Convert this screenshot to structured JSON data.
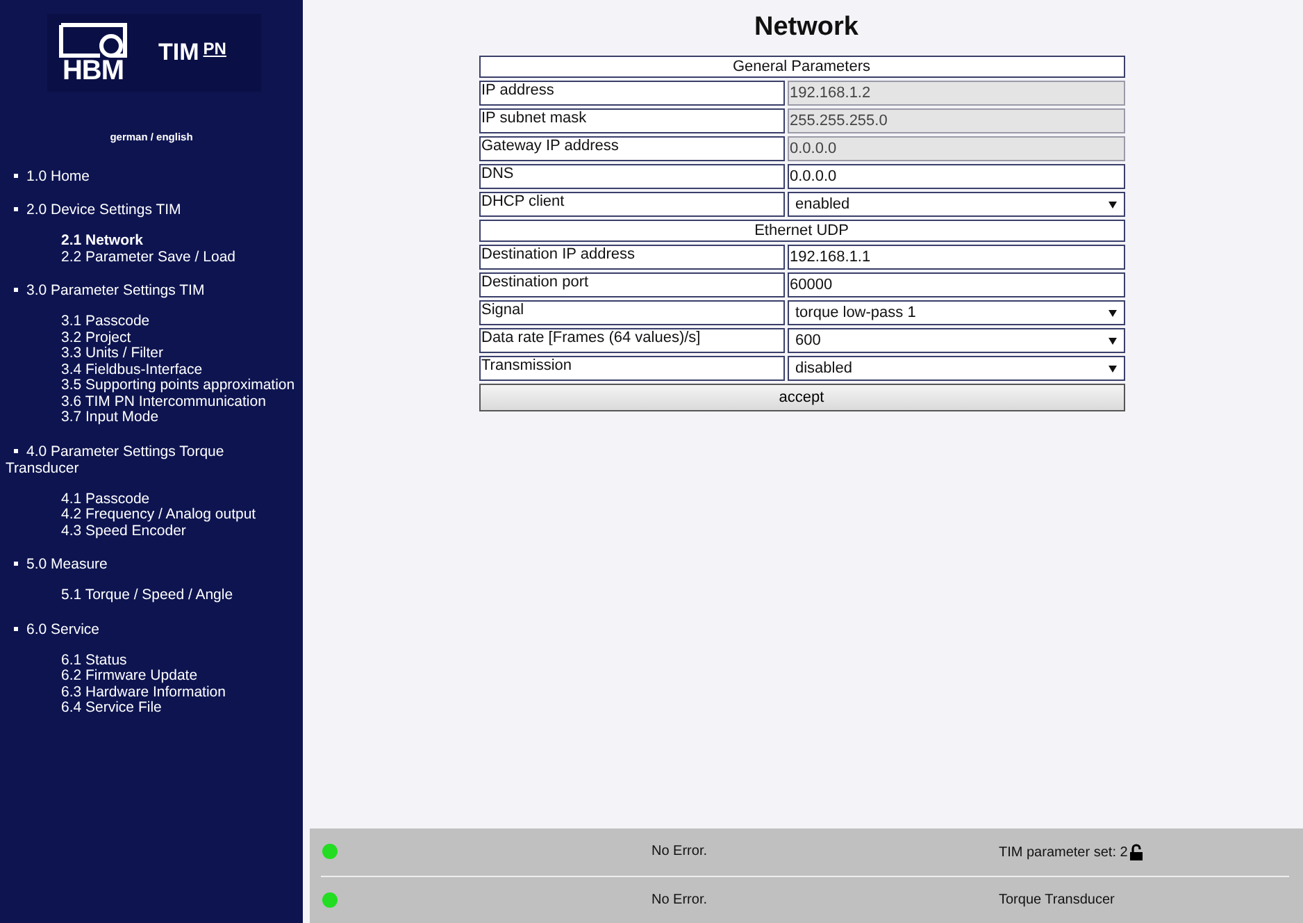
{
  "logo": {
    "brand": "HBM",
    "product": "TIM",
    "product_suffix": "PN"
  },
  "language_switch": "german / english",
  "nav": [
    {
      "label": "1.0 Home",
      "selected": false
    },
    {
      "label": "2.0 Device Settings TIM",
      "selected": false,
      "children": [
        {
          "label": "2.1 Network",
          "selected": true
        },
        {
          "label": "2.2 Parameter Save / Load",
          "selected": false
        }
      ]
    },
    {
      "label": "3.0 Parameter Settings TIM",
      "selected": false,
      "children": [
        {
          "label": "3.1 Passcode",
          "selected": false
        },
        {
          "label": "3.2 Project",
          "selected": false
        },
        {
          "label": "3.3 Units / Filter",
          "selected": false
        },
        {
          "label": "3.4 Fieldbus-Interface",
          "selected": false
        },
        {
          "label": "3.5 Supporting points approximation",
          "selected": false
        },
        {
          "label": "3.6 TIM PN Intercommunication",
          "selected": false
        },
        {
          "label": "3.7 Input Mode",
          "selected": false
        }
      ]
    },
    {
      "label": "4.0 Parameter Settings Torque Transducer",
      "selected": false,
      "children": [
        {
          "label": "4.1 Passcode",
          "selected": false
        },
        {
          "label": "4.2 Frequency / Analog output",
          "selected": false
        },
        {
          "label": "4.3 Speed Encoder",
          "selected": false
        }
      ]
    },
    {
      "label": "5.0 Measure",
      "selected": false,
      "children": [
        {
          "label": "5.1 Torque / Speed / Angle",
          "selected": false
        }
      ]
    },
    {
      "label": "6.0 Service",
      "selected": false,
      "children": [
        {
          "label": "6.1 Status",
          "selected": false
        },
        {
          "label": "6.2 Firmware Update",
          "selected": false
        },
        {
          "label": "6.3 Hardware Information",
          "selected": false
        },
        {
          "label": "6.4 Service File",
          "selected": false
        }
      ]
    }
  ],
  "page_title": "Network",
  "form": [
    {
      "kind": "section",
      "label": "General Parameters"
    },
    {
      "kind": "input",
      "label": "IP address",
      "value": "192.168.1.2",
      "disabled": true
    },
    {
      "kind": "input",
      "label": "IP subnet mask",
      "value": "255.255.255.0",
      "disabled": true
    },
    {
      "kind": "input",
      "label": "Gateway IP address",
      "value": "0.0.0.0",
      "disabled": true
    },
    {
      "kind": "input",
      "label": "DNS",
      "value": "0.0.0.0",
      "disabled": false
    },
    {
      "kind": "select",
      "label": "DHCP client",
      "value": "enabled"
    },
    {
      "kind": "section",
      "label": "Ethernet UDP"
    },
    {
      "kind": "input",
      "label": "Destination IP address",
      "value": "192.168.1.1",
      "disabled": false
    },
    {
      "kind": "input",
      "label": "Destination port",
      "value": "60000",
      "disabled": false
    },
    {
      "kind": "select",
      "label": "Signal",
      "value": "torque low-pass 1"
    },
    {
      "kind": "select",
      "label": "Data rate [Frames (64 values)/s]",
      "value": "600"
    },
    {
      "kind": "select",
      "label": "Transmission",
      "value": "disabled"
    }
  ],
  "accept_button": "accept",
  "status_bar": [
    {
      "color": "#22dd22",
      "message": "No Error.",
      "info": "TIM parameter set: 2",
      "locked": false
    },
    {
      "color": "#22dd22",
      "message": "No Error.",
      "info": "Torque Transducer"
    }
  ]
}
